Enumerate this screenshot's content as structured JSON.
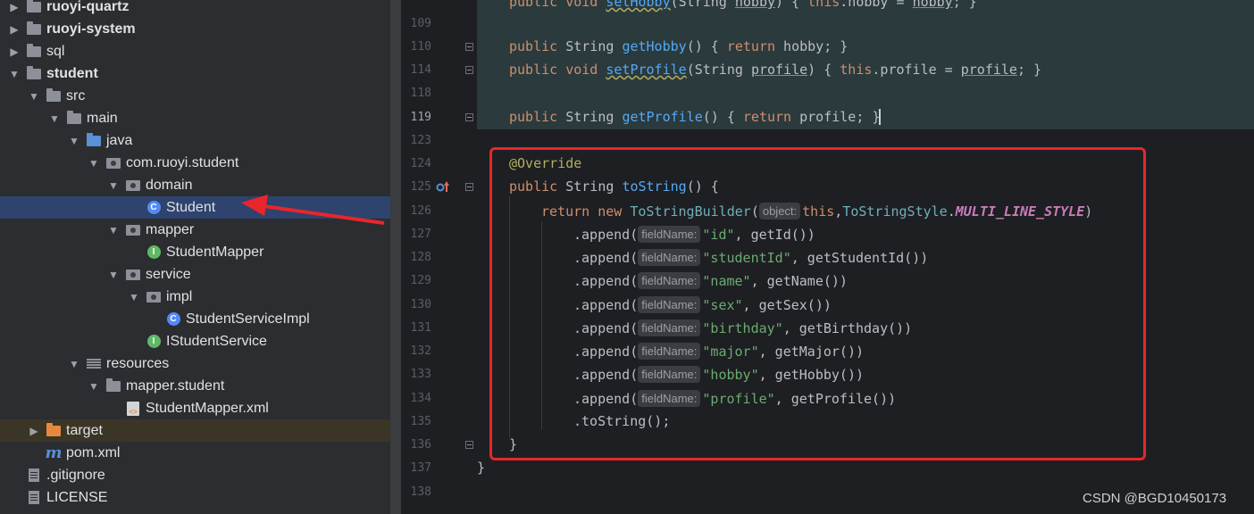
{
  "tree": {
    "items": [
      {
        "label": "ruoyi-quartz",
        "icon": "module-folder-icon",
        "expanded": false
      },
      {
        "label": "ruoyi-system",
        "icon": "module-folder-icon",
        "expanded": false
      },
      {
        "label": "sql",
        "icon": "folder-icon",
        "expanded": false
      },
      {
        "label": "student",
        "icon": "module-folder-icon",
        "expanded": true
      },
      {
        "label": "src",
        "icon": "folder-icon",
        "expanded": true
      },
      {
        "label": "main",
        "icon": "folder-icon",
        "expanded": true
      },
      {
        "label": "java",
        "icon": "source-folder-icon",
        "expanded": true
      },
      {
        "label": "com.ruoyi.student",
        "icon": "package-icon",
        "expanded": true
      },
      {
        "label": "domain",
        "icon": "package-icon",
        "expanded": true
      },
      {
        "label": "Student",
        "icon": "class-icon",
        "selected": true
      },
      {
        "label": "mapper",
        "icon": "package-icon",
        "expanded": true
      },
      {
        "label": "StudentMapper",
        "icon": "interface-icon"
      },
      {
        "label": "service",
        "icon": "package-icon",
        "expanded": true
      },
      {
        "label": "impl",
        "icon": "package-icon",
        "expanded": true
      },
      {
        "label": "StudentServiceImpl",
        "icon": "class-icon"
      },
      {
        "label": "IStudentService",
        "icon": "interface-icon"
      },
      {
        "label": "resources",
        "icon": "resources-folder-icon",
        "expanded": true
      },
      {
        "label": "mapper.student",
        "icon": "folder-icon",
        "expanded": true
      },
      {
        "label": "StudentMapper.xml",
        "icon": "xml-file-icon"
      },
      {
        "label": "target",
        "icon": "excluded-folder-icon",
        "expanded": false
      },
      {
        "label": "pom.xml",
        "icon": "maven-icon"
      },
      {
        "label": ".gitignore",
        "icon": "file-icon"
      },
      {
        "label": "LICENSE",
        "icon": "file-icon"
      }
    ],
    "icon_glyphs": {
      "class": "C",
      "interface": "I",
      "xml": "<>",
      "maven": "m"
    }
  },
  "editor": {
    "lines": [
      {
        "n": "109"
      },
      {
        "n": "110"
      },
      {
        "n": "114"
      },
      {
        "n": "118"
      },
      {
        "n": "119"
      },
      {
        "n": "123"
      },
      {
        "n": "124"
      },
      {
        "n": "125"
      },
      {
        "n": "126"
      },
      {
        "n": "127"
      },
      {
        "n": "128"
      },
      {
        "n": "129"
      },
      {
        "n": "130"
      },
      {
        "n": "131"
      },
      {
        "n": "132"
      },
      {
        "n": "133"
      },
      {
        "n": "134"
      },
      {
        "n": "135"
      },
      {
        "n": "136"
      },
      {
        "n": "137"
      },
      {
        "n": "138"
      }
    ],
    "top_partial": {
      "kw1": "public",
      "kw2": "void",
      "fn": "setHobby",
      "p1": "(String ",
      "param": "hobby",
      "p2": ") { ",
      "kw3": "this",
      ".hobby = ": ".hobby = ",
      "param2": "hobby",
      "end": "; }"
    },
    "getHobby": {
      "kw": "public",
      "type": " String ",
      "fn": "getHobby",
      "rest": "() { ",
      "kw2": "return",
      "end": " hobby; }"
    },
    "setProfile": {
      "kw": "public",
      "kw2": " void ",
      "fn": "setProfile",
      "p1": "(String ",
      "param": "profile",
      "p2": ") { ",
      "kw3": "this",
      "mid": ".profile = ",
      "param2": "profile",
      "end": "; }"
    },
    "getProfile": {
      "kw": "public",
      "type": " String ",
      "fn": "getProfile",
      "rest": "() { ",
      "kw2": "return",
      "end": " profile; }"
    },
    "override": "@Override",
    "toStringDecl": {
      "kw": "public",
      "type": " String ",
      "fn": "toString",
      "rest": "() {"
    },
    "returnLine": {
      "kw": "return",
      "kw2": "new",
      "cls": "ToStringBuilder",
      "open": "(",
      "hint": "object:",
      "kw3": "this",
      "comma": ",",
      "cls2": "ToStringStyle",
      "dot": ".",
      "cst": "MULTI_LINE_STYLE",
      "close": ")"
    },
    "appends": [
      {
        "call": ".append(",
        "hint": "fieldName:",
        "str": "\"id\"",
        "rest": ", getId())"
      },
      {
        "call": ".append(",
        "hint": "fieldName:",
        "str": "\"studentId\"",
        "rest": ", getStudentId())"
      },
      {
        "call": ".append(",
        "hint": "fieldName:",
        "str": "\"name\"",
        "rest": ", getName())"
      },
      {
        "call": ".append(",
        "hint": "fieldName:",
        "str": "\"sex\"",
        "rest": ", getSex())"
      },
      {
        "call": ".append(",
        "hint": "fieldName:",
        "str": "\"birthday\"",
        "rest": ", getBirthday())"
      },
      {
        "call": ".append(",
        "hint": "fieldName:",
        "str": "\"major\"",
        "rest": ", getMajor())"
      },
      {
        "call": ".append(",
        "hint": "fieldName:",
        "str": "\"hobby\"",
        "rest": ", getHobby())"
      },
      {
        "call": ".append(",
        "hint": "fieldName:",
        "str": "\"profile\"",
        "rest": ", getProfile())"
      }
    ],
    "toStringCall": ".toString();",
    "closeMethod": "}",
    "closeClass": "}"
  },
  "watermark": "CSDN @BGD10450173",
  "colors": {
    "highlight_box": "#e8262b",
    "selection": "#2e436e",
    "keyword": "#cf8e6d",
    "string": "#6aab73",
    "function": "#56a8f5"
  }
}
